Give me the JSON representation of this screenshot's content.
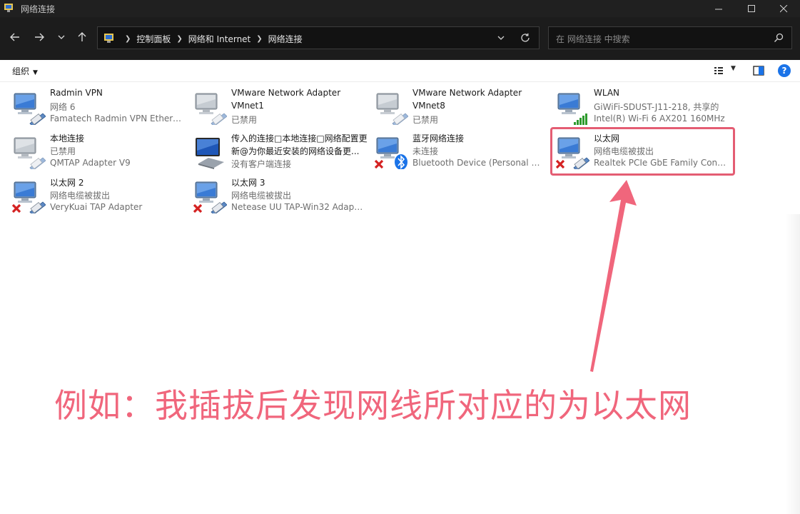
{
  "window": {
    "title": "网络连接"
  },
  "breadcrumbs": [
    "控制面板",
    "网络和 Internet",
    "网络连接"
  ],
  "search": {
    "placeholder": "在 网络连接 中搜索"
  },
  "toolbar": {
    "organize": "组织"
  },
  "items": [
    {
      "name": "Radmin VPN",
      "status": "网络 6",
      "device": "Famatech Radmin VPN Ethern...",
      "icon": "network-adapter-icon",
      "badge": "none"
    },
    {
      "name": "VMware Network Adapter VMnet1",
      "name_line1": "VMware Network Adapter",
      "name_line2": "VMnet1",
      "status": "已禁用",
      "icon": "network-adapter-disabled-icon",
      "badge": "none"
    },
    {
      "name": "VMware Network Adapter VMnet8",
      "name_line1": "VMware Network Adapter",
      "name_line2": "VMnet8",
      "status": "已禁用",
      "icon": "network-adapter-disabled-icon",
      "badge": "none"
    },
    {
      "name": "WLAN",
      "status": "GiWiFi-SDUST-J11-218, 共享的",
      "device": "Intel(R) Wi-Fi 6 AX201 160MHz",
      "icon": "wifi-adapter-icon",
      "badge": "signal"
    },
    {
      "name": "本地连接",
      "status": "已禁用",
      "device": "QMTAP Adapter V9",
      "icon": "network-adapter-disabled-icon",
      "badge": "none"
    },
    {
      "name_line1": "传入的连接□本地连接□网络配置更",
      "name_line2": "新@为你最近安装的网络设备更...",
      "status": "没有客户端连接",
      "icon": "incoming-connection-icon",
      "badge": "none"
    },
    {
      "name": "蓝牙网络连接",
      "status": "未连接",
      "device": "Bluetooth Device (Personal Ar...",
      "icon": "bluetooth-network-icon",
      "badge": "x"
    },
    {
      "name": "以太网",
      "status": "网络电缆被拔出",
      "device": "Realtek PCIe GbE Family Contr...",
      "icon": "ethernet-adapter-icon",
      "badge": "x"
    },
    {
      "name": "以太网 2",
      "status": "网络电缆被拔出",
      "device": "VeryKuai TAP Adapter",
      "icon": "ethernet-adapter-icon",
      "badge": "x"
    },
    {
      "name": "以太网 3",
      "status": "网络电缆被拔出",
      "device": "Netease UU TAP-Win32 Adapt...",
      "icon": "ethernet-adapter-icon",
      "badge": "x"
    }
  ],
  "annotation": {
    "text": "例如：我插拔后发现网线所对应的为以太网",
    "color": "#f0667c"
  }
}
